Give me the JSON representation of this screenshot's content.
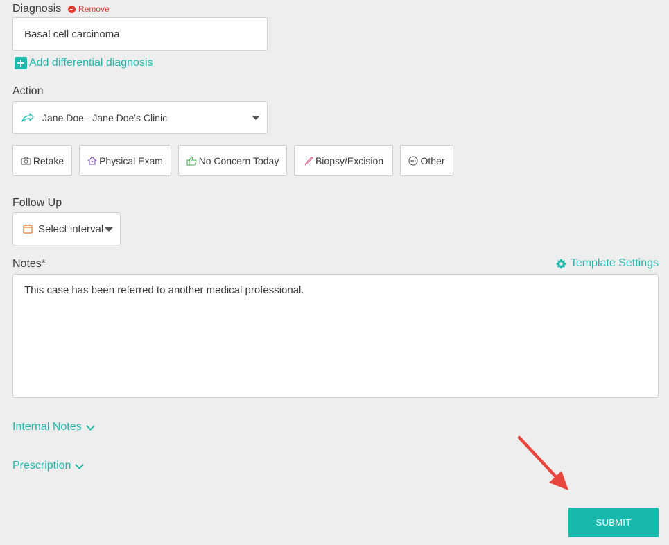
{
  "diagnosis": {
    "label": "Diagnosis",
    "remove_label": "Remove",
    "value": "Basal cell carcinoma"
  },
  "add_differential": {
    "label": "Add differential diagnosis"
  },
  "action": {
    "label": "Action",
    "selected": "Jane Doe - Jane Doe's Clinic",
    "buttons": [
      {
        "label": "Retake",
        "icon": "camera-icon"
      },
      {
        "label": "Physical Exam",
        "icon": "house-icon"
      },
      {
        "label": "No Concern Today",
        "icon": "thumbs-up-icon"
      },
      {
        "label": "Biopsy/Excision",
        "icon": "scalpel-icon"
      },
      {
        "label": "Other",
        "icon": "ellipsis-circle-icon"
      }
    ]
  },
  "follow_up": {
    "label": "Follow Up",
    "placeholder": "Select interval"
  },
  "notes": {
    "label": "Notes*",
    "template_settings": "Template Settings",
    "value": "This case has been referred to another medical professional."
  },
  "sections": {
    "internal_notes": "Internal Notes",
    "prescription": "Prescription"
  },
  "submit_label": "SUBMIT",
  "colors": {
    "accent": "#1fb9ae",
    "remove": "#e5392f",
    "background": "#eeeeee"
  }
}
